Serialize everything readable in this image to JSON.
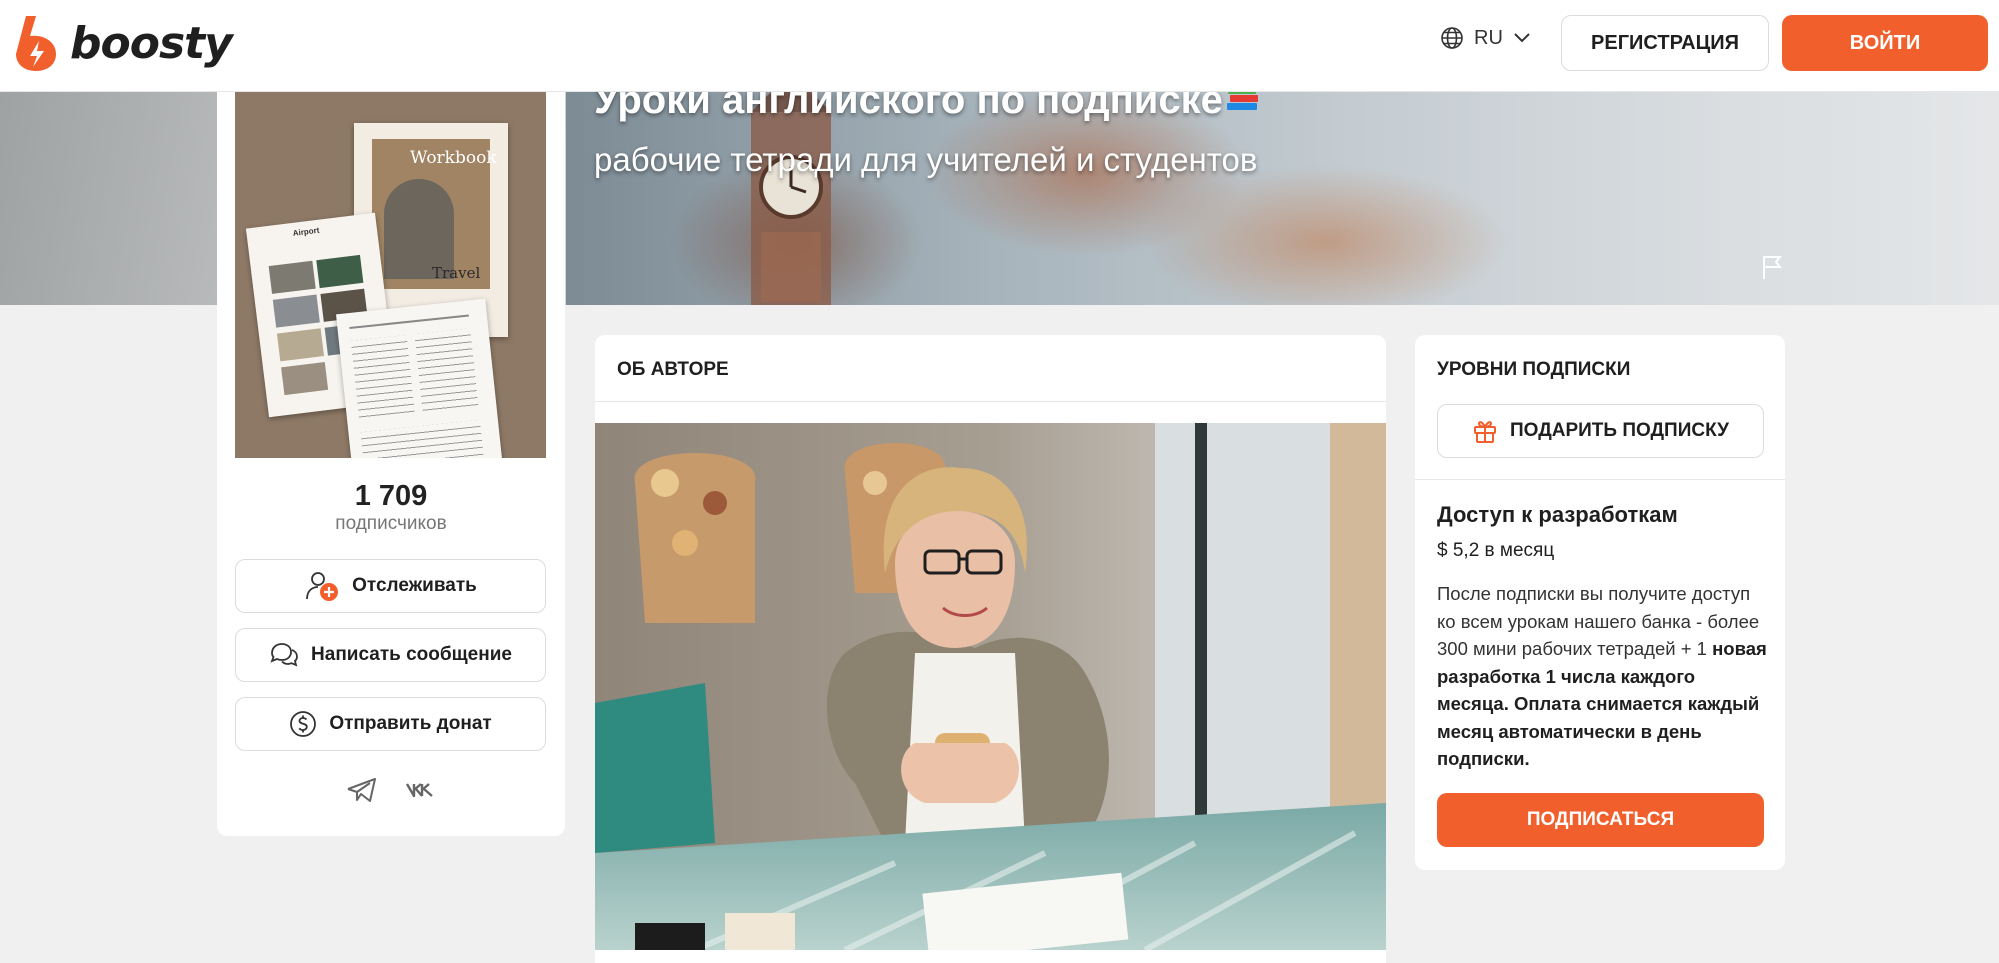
{
  "header": {
    "logo_text": "boosty",
    "language": "RU",
    "register_label": "РЕГИСТРАЦИЯ",
    "login_label": "ВОЙТИ"
  },
  "cover": {
    "title": "Уроки английского по подписке",
    "subtitle": "рабочие тетради для учителей и студентов"
  },
  "profile": {
    "avatar_text": {
      "workbook": "Workbook",
      "travel": "Travel",
      "airport": "Airport"
    },
    "subscribers_count": "1 709",
    "subscribers_label": "подписчиков",
    "follow_label": "Отслеживать",
    "message_label": "Написать сообщение",
    "donate_label": "Отправить донат",
    "socials": [
      "telegram-icon",
      "vk-icon"
    ]
  },
  "about": {
    "heading": "ОБ АВТОРЕ"
  },
  "tiers": {
    "heading": "УРОВНИ ПОДПИСКИ",
    "gift_label": "ПОДАРИТЬ ПОДПИСКУ",
    "tier_title": "Доступ к разработкам",
    "tier_price": "$ 5,2 в месяц",
    "tier_desc_plain": "После подписки вы получите доступ ко всем урокам нашего банка - более 300 мини рабочих тетрадей + 1 ",
    "tier_desc_bold": "новая разработка 1 числа каждого месяца. Оплата снимается каждый месяц автоматически в день подписки.",
    "subscribe_label": "ПОДПИСАТЬСЯ"
  },
  "colors": {
    "accent": "#f15f2c",
    "background": "#f0f0f0",
    "card": "#ffffff"
  }
}
